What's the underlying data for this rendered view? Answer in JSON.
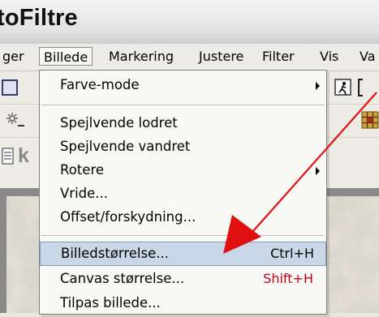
{
  "window": {
    "title": "toFiltre"
  },
  "menubar": {
    "items": [
      "ger",
      "Billede",
      "Markering",
      "Justere",
      "Filter",
      "Vis",
      "Va"
    ],
    "active": "Billede"
  },
  "side_fragment": "k",
  "billede_menu": {
    "items": [
      {
        "label": "Farve-mode",
        "submenu": true
      },
      {
        "label": "Spejlvende lodret"
      },
      {
        "label": "Spejlvende vandret"
      },
      {
        "label": "Rotere",
        "submenu": true
      },
      {
        "label": "Vride..."
      },
      {
        "label": "Offset/forskydning..."
      },
      {
        "label": "Billedstørrelse...",
        "shortcut": "Ctrl+H",
        "highlighted": true
      },
      {
        "label": "Canvas størrelse...",
        "shortcut": "Shift+H",
        "shortcut_color": "#c0001a"
      },
      {
        "label": "Tilpas billede..."
      }
    ]
  },
  "colors": {
    "annotation_arrow": "#e01010",
    "highlight_bg": "#c9d7e6",
    "shortcut_red": "#c0001a"
  },
  "icons": [
    "disk-icon",
    "sun-icon",
    "document-icon",
    "runner-icon",
    "grid-icon"
  ]
}
